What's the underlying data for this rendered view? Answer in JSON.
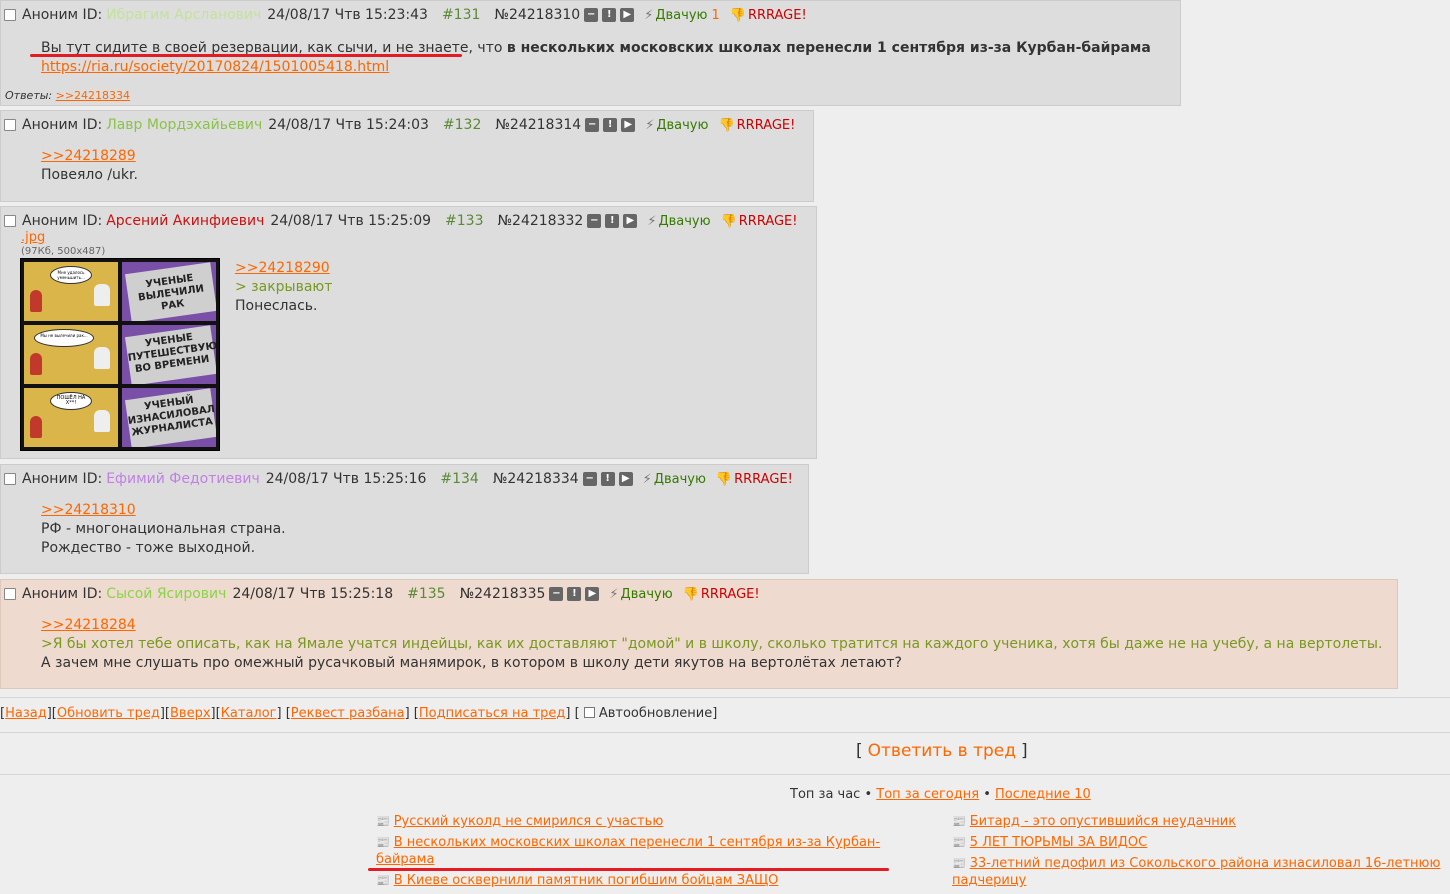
{
  "posts": [
    {
      "anon": "Аноним ID:",
      "id_name": "Ибрагим Арсланович",
      "id_color": "#c3e29b",
      "date": "24/08/17 Чтв 15:23:43",
      "num": "#131",
      "no": "№24218310",
      "like": "Двачую",
      "like_count": "1",
      "dislike": "RRRAGE!",
      "text_a": "Вы тут сидите в своей резервации, как сычи, и не знаете",
      "text_b": ", что ",
      "text_bold": "в нескольких московских школах перенесли 1 сентября из-за Курбан-байрама",
      "link": "https://ria.ru/society/20170824/1501005418.html",
      "replies_label": "Ответы:",
      "reply_link": ">>24218334"
    },
    {
      "anon": "Аноним ID:",
      "id_name": "Лавр Мордэхайьевич",
      "id_color": "#8bc34a",
      "date": "24/08/17 Чтв 15:24:03",
      "num": "#132",
      "no": "№24218314",
      "like": "Двачую",
      "dislike": "RRRAGE!",
      "reply_ref": ">>24218289",
      "line1": "Повеяло /ukr."
    },
    {
      "anon": "Аноним ID:",
      "id_name": "Арсений Акинфиевич",
      "id_color": "#cc1111",
      "date": "24/08/17 Чтв 15:25:09",
      "num": "#133",
      "no": "№24218332",
      "like": "Двачую",
      "dislike": "RRRAGE!",
      "file_name": ".jpg",
      "file_meta": "(97Кб, 500x487)",
      "reply_ref": ">>24218290",
      "quote": "> закрывают",
      "line1": "Понеслась.",
      "comic": {
        "bubble1": "Мне удалось уменьшить...",
        "paper1": "УЧЕНЫЕ ВЫЛЕЧИЛИ РАК",
        "bubble2": "Мы не вылечили рак...",
        "paper2": "УЧЕНЫЕ ПУТЕШЕСТВУЮТ ВО ВРЕМЕНИ",
        "bubble3": "ПОШЁЛ НА Х**!",
        "paper3": "УЧЕНЫЙ ИЗНАСИЛОВАЛ ЖУРНАЛИСТА"
      }
    },
    {
      "anon": "Аноним ID:",
      "id_name": "Ефимий Федотиевич",
      "id_color": "#c27fe6",
      "date": "24/08/17 Чтв 15:25:16",
      "num": "#134",
      "no": "№24218334",
      "like": "Двачую",
      "dislike": "RRRAGE!",
      "reply_ref": ">>24218310",
      "line1": "РФ - многонациональная страна.",
      "line2": "Рождество - тоже выходной."
    },
    {
      "anon": "Аноним ID:",
      "id_name": "Сысой Ясирович",
      "id_color": "#8bd44a",
      "date": "24/08/17 Чтв 15:25:18",
      "num": "#135",
      "no": "№24218335",
      "like": "Двачую",
      "dislike": "RRRAGE!",
      "reply_ref": ">>24218284",
      "quote": ">Я бы хотел тебе описать, как на Ямале учатся индейцы, как их доставляют \"домой\" и в школу, сколько тратится на каждого ученика, хотя бы даже не на учебу, а на вертолеты.",
      "line1": "А зачем мне слушать про омежный русачковый манямирок, в котором в школу дети якутов на вертолётах летают?"
    }
  ],
  "nav": {
    "back": "Назад",
    "refresh": "Обновить тред",
    "up": "Вверх",
    "catalog": "Каталог",
    "request": "Реквест разбана",
    "subscribe": "Подписаться на тред",
    "auto": "Автообновление"
  },
  "reply_button": "Ответить в тред",
  "top": {
    "hour": "Топ за час",
    "today": "Топ за сегодня",
    "last": "Последние 10",
    "left": [
      "Русский куколд не смирился с участью",
      "В нескольких московских школах перенесли 1 сентября из-за Курбан-байрама",
      "В Киеве осквернили памятник погибшим бойцам ЗАЩО"
    ],
    "right": [
      "Битард - это опустившийся неудачник",
      "5 ЛЕТ ТЮРЬМЫ ЗА ВИДОС",
      "33-летний педофил из Сокольского района изнасиловал 16-летнюю падчерицу"
    ]
  },
  "colors": {
    "link": "#ff6600",
    "quote": "#789922",
    "rage": "#cc0000",
    "like": "#357b00",
    "annotation": "#e31b23"
  }
}
